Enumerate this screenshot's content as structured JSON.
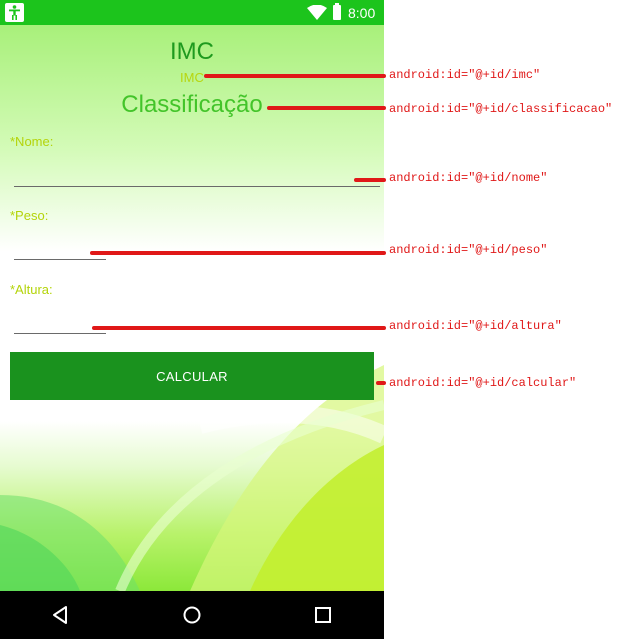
{
  "status_bar": {
    "time": "8:00",
    "accessibility_icon": "accessibility-icon",
    "wifi_icon": "wifi-icon",
    "battery_icon": "battery-icon"
  },
  "screen": {
    "title": "IMC",
    "imc_value": "IMC",
    "classificacao": "Classificação",
    "fields": {
      "nome_label": "*Nome:",
      "peso_label": "*Peso:",
      "altura_label": "*Altura:"
    },
    "calcular_label": "CALCULAR"
  },
  "nav_bar": {
    "back_icon": "back-triangle-icon",
    "home_icon": "home-circle-icon",
    "recents_icon": "recents-square-icon"
  },
  "annotations": {
    "imc": "android:id=\"@+id/imc\"",
    "classificacao": "android:id=\"@+id/classificacao\"",
    "nome": "android:id=\"@+id/nome\"",
    "peso": "android:id=\"@+id/peso\"",
    "altura": "android:id=\"@+id/altura\"",
    "calcular": "android:id=\"@+id/calcular\""
  },
  "colors": {
    "status_bar": "#1cc41c",
    "button": "#1a921e",
    "annotation": "#e01818",
    "label": "#b4d40a"
  }
}
